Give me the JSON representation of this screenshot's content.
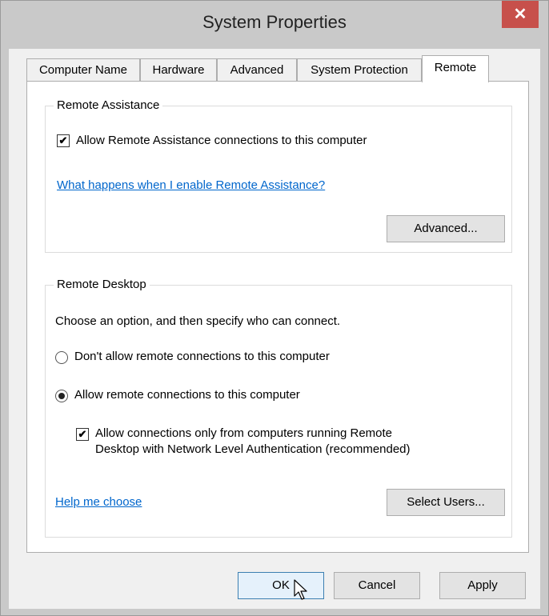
{
  "window": {
    "title": "System Properties",
    "close_glyph": "✕"
  },
  "tabs": [
    {
      "label": "Computer Name"
    },
    {
      "label": "Hardware"
    },
    {
      "label": "Advanced"
    },
    {
      "label": "System Protection"
    },
    {
      "label": "Remote"
    }
  ],
  "remote_assistance": {
    "title": "Remote Assistance",
    "allow_label": "Allow Remote Assistance connections to this computer",
    "allow_checked": true,
    "help_link": "What happens when I enable Remote Assistance?",
    "advanced_button": "Advanced..."
  },
  "remote_desktop": {
    "title": "Remote Desktop",
    "instruction": "Choose an option, and then specify who can connect.",
    "option_dont": "Don't allow remote connections to this computer",
    "option_allow": "Allow remote connections to this computer",
    "selected_option": "allow",
    "nla_label_line1": "Allow connections only from computers running Remote",
    "nla_label_line2": "Desktop with Network Level Authentication (recommended)",
    "nla_checked": true,
    "help_link": "Help me choose",
    "select_users_button": "Select Users..."
  },
  "footer": {
    "ok": "OK",
    "cancel": "Cancel",
    "apply": "Apply"
  },
  "colors": {
    "link": "#0066cc",
    "close": "#c7504b",
    "focus_border": "#3c7fb1"
  },
  "icons": {
    "close": "close-icon",
    "check": "checkmark-icon",
    "cursor": "mouse-pointer-icon"
  }
}
